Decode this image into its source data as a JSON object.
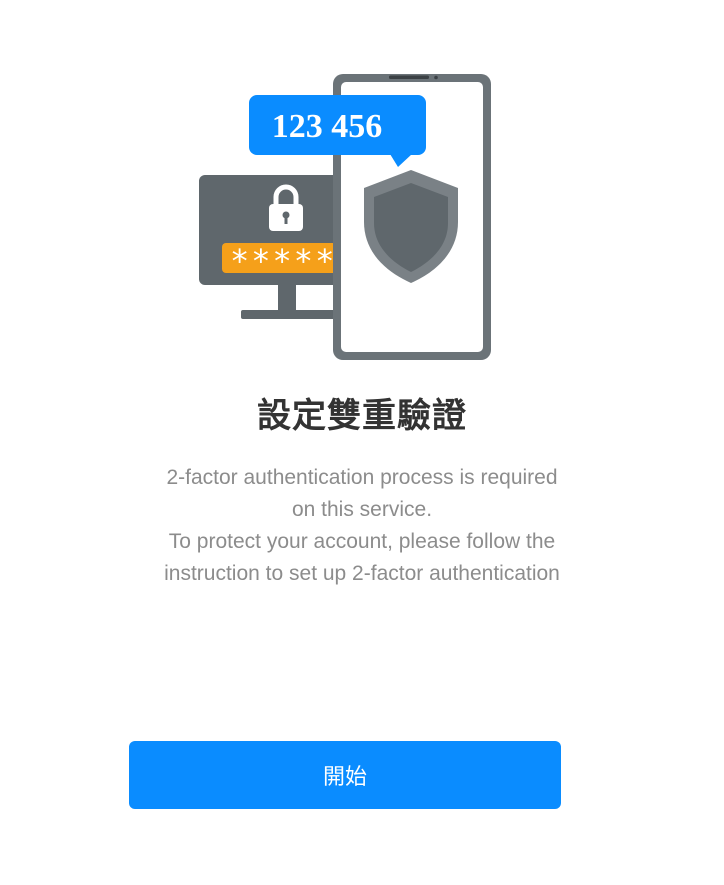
{
  "hero": {
    "code_text": "123 456",
    "password_mask": "*****"
  },
  "title": "設定雙重驗證",
  "description": {
    "lines": [
      "2-factor authentication process is required",
      "on this service.",
      "To protect your account, please follow the",
      "instruction to set up 2-factor authentication"
    ]
  },
  "start_button_label": "開始",
  "colors": {
    "accent": "#0a8cff",
    "orange": "#f5a01a",
    "device_gray": "#6b7378",
    "shield_dark": "#5f676c"
  }
}
